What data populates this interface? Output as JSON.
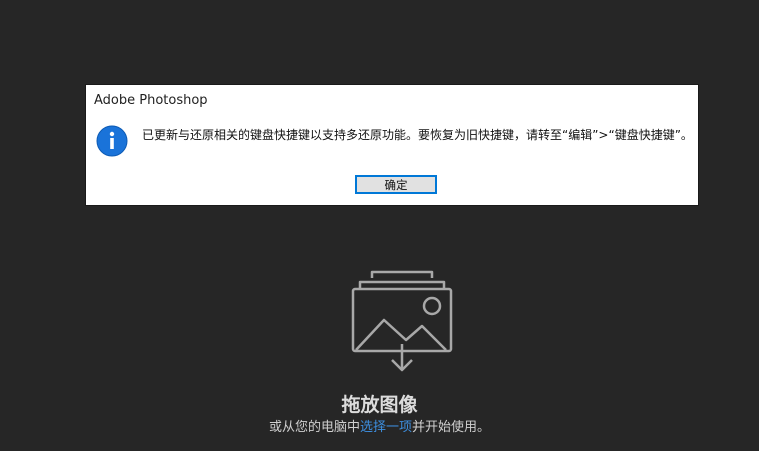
{
  "dialog": {
    "title": "Adobe Photoshop",
    "message": "已更新与还原相关的键盘快捷键以支持多还原功能。要恢复为旧快捷键，请转至“编辑”>“键盘快捷键”。",
    "ok_label": "确定",
    "icon": "info-icon"
  },
  "workspace": {
    "drop_title": "拖放图像",
    "drop_subtitle_prefix": "或从您的电脑中",
    "drop_subtitle_link": "选择一项",
    "drop_subtitle_suffix": "并开始使用。",
    "illustration_icon": "image-drop-icon"
  },
  "colors": {
    "background": "#262626",
    "dialog_bg": "#ffffff",
    "accent": "#0078d7",
    "link": "#3d8fe0"
  }
}
